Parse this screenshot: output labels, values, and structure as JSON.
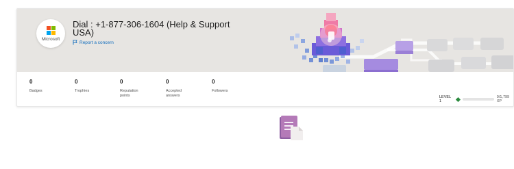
{
  "profile": {
    "avatar_label": "Microsoft",
    "title": "Dial : +1-877-306-1604 (Help & Support USA)",
    "report_link": "Report a concern",
    "report_icon": "flag-icon",
    "logo_colors": [
      "#f25022",
      "#7fba00",
      "#00a4ef",
      "#ffb900"
    ]
  },
  "stats": [
    {
      "value": "0",
      "label": "Badges"
    },
    {
      "value": "0",
      "label": "Trophies"
    },
    {
      "value": "0",
      "label": "Reputation points"
    },
    {
      "value": "0",
      "label": "Accepted answers"
    },
    {
      "value": "0",
      "label": "Followers"
    }
  ],
  "level": {
    "label": "LEVEL 1",
    "xp_text": "0/1,799 XP",
    "progress_fraction": 0.0,
    "accent_color": "#2b8a3e"
  },
  "empty_state": {
    "icon": "document-icon"
  }
}
